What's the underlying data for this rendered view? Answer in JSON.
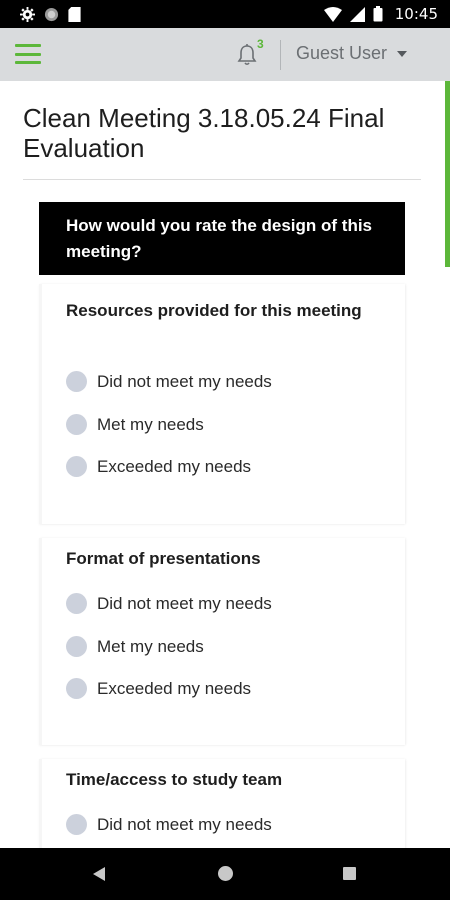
{
  "status_bar": {
    "time": "10:45",
    "icons": [
      "settings-icon",
      "circle-icon",
      "sd-card-icon",
      "wifi-icon",
      "signal-icon",
      "battery-icon"
    ]
  },
  "header": {
    "notification_count": "3",
    "user_name": "Guest User",
    "accent_color": "#5cb73a"
  },
  "page": {
    "title": "Clean Meeting 3.18.05.24 Final Evaluation"
  },
  "section": {
    "heading": "How would you rate the design of this meeting?"
  },
  "questions": [
    {
      "label": "Resources provided for this meeting",
      "options": [
        "Did not meet my needs",
        "Met my needs",
        "Exceeded my needs"
      ]
    },
    {
      "label": "Format of presentations",
      "options": [
        "Did not meet my needs",
        "Met my needs",
        "Exceeded my needs"
      ]
    },
    {
      "label": "Time/access to study team",
      "options": [
        "Did not meet my needs"
      ]
    }
  ]
}
